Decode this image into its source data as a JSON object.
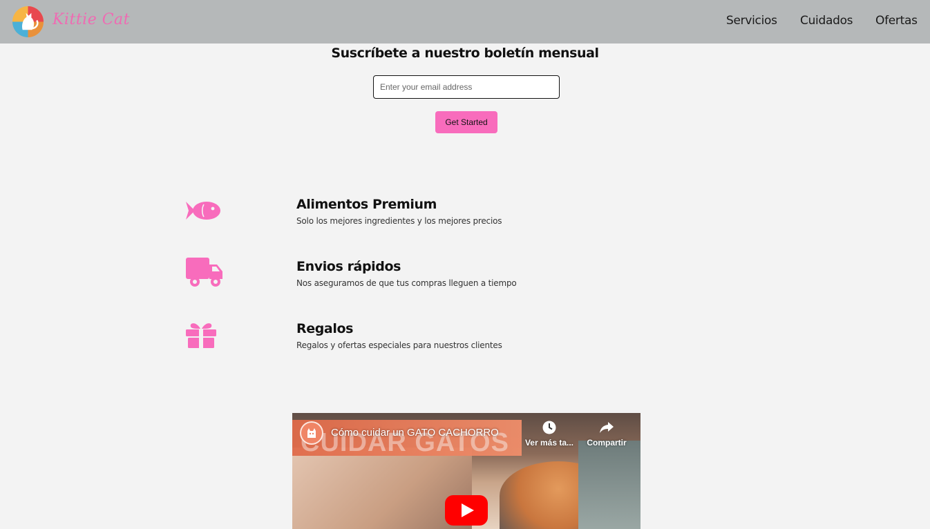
{
  "nav": {
    "brand": "Kittie Cat",
    "links": [
      "Servicios",
      "Cuidados",
      "Ofertas"
    ]
  },
  "newsletter": {
    "title": "Suscríbete a nuestro boletín mensual",
    "email_placeholder": "Enter your email address",
    "button_label": "Get Started"
  },
  "features": [
    {
      "icon": "fish-icon",
      "title": "Alimentos Premium",
      "description": "Solo los mejores ingredientes y los mejores precios"
    },
    {
      "icon": "truck-icon",
      "title": "Envios rápidos",
      "description": "Nos aseguramos de que tus compras lleguen a tiempo"
    },
    {
      "icon": "gift-icon",
      "title": "Regalos",
      "description": "Regalos y ofertas especiales para nuestros clientes"
    }
  ],
  "video": {
    "title": "Cómo cuidar un GATO CACHORRO",
    "banner_text": "CUIDAR GATOS",
    "watch_later_label": "Ver más ta...",
    "share_label": "Compartir"
  },
  "colors": {
    "accent": "#f86cbc",
    "navbar": "#b5b8b9",
    "background": "#f3f3f3"
  }
}
